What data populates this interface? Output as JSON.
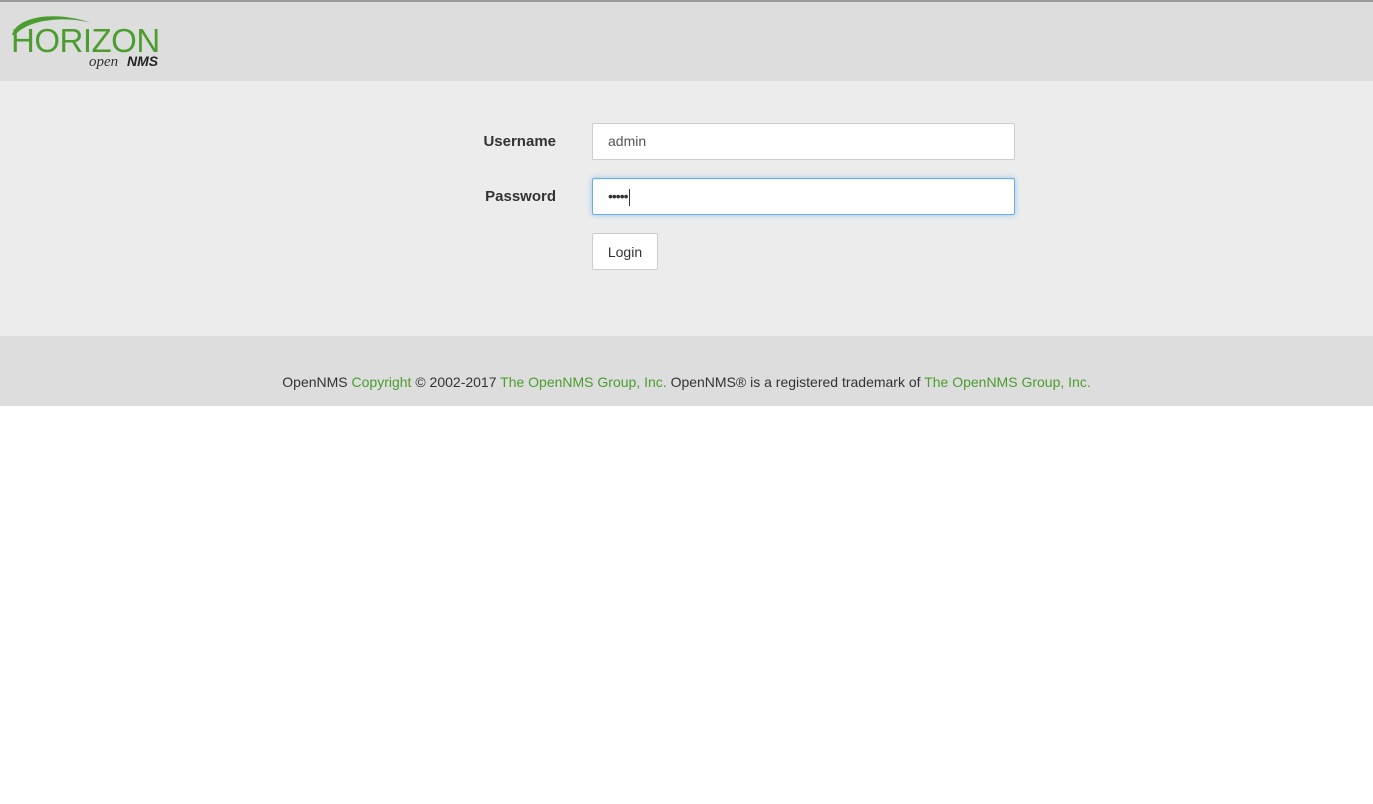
{
  "header": {
    "logo": {
      "icon": "opennms-horizon-logo",
      "brand_text": "HORIZON",
      "sub_text_open": "open",
      "sub_text_nms": "NMS",
      "colors": {
        "green": "#4c9d2f",
        "dark": "#333333"
      }
    }
  },
  "login": {
    "username_label": "Username",
    "username_value": "admin",
    "password_label": "Password",
    "password_masked": "•••••",
    "login_button": "Login"
  },
  "footer": {
    "prefix": "OpenNMS",
    "copyright_link": "Copyright",
    "years": "© 2002-2017",
    "group_link_1": "The OpenNMS Group, Inc.",
    "trademark_text": "OpenNMS® is a registered trademark of",
    "group_link_2": "The OpenNMS Group, Inc.",
    "link_color": "#4c9d2f"
  }
}
